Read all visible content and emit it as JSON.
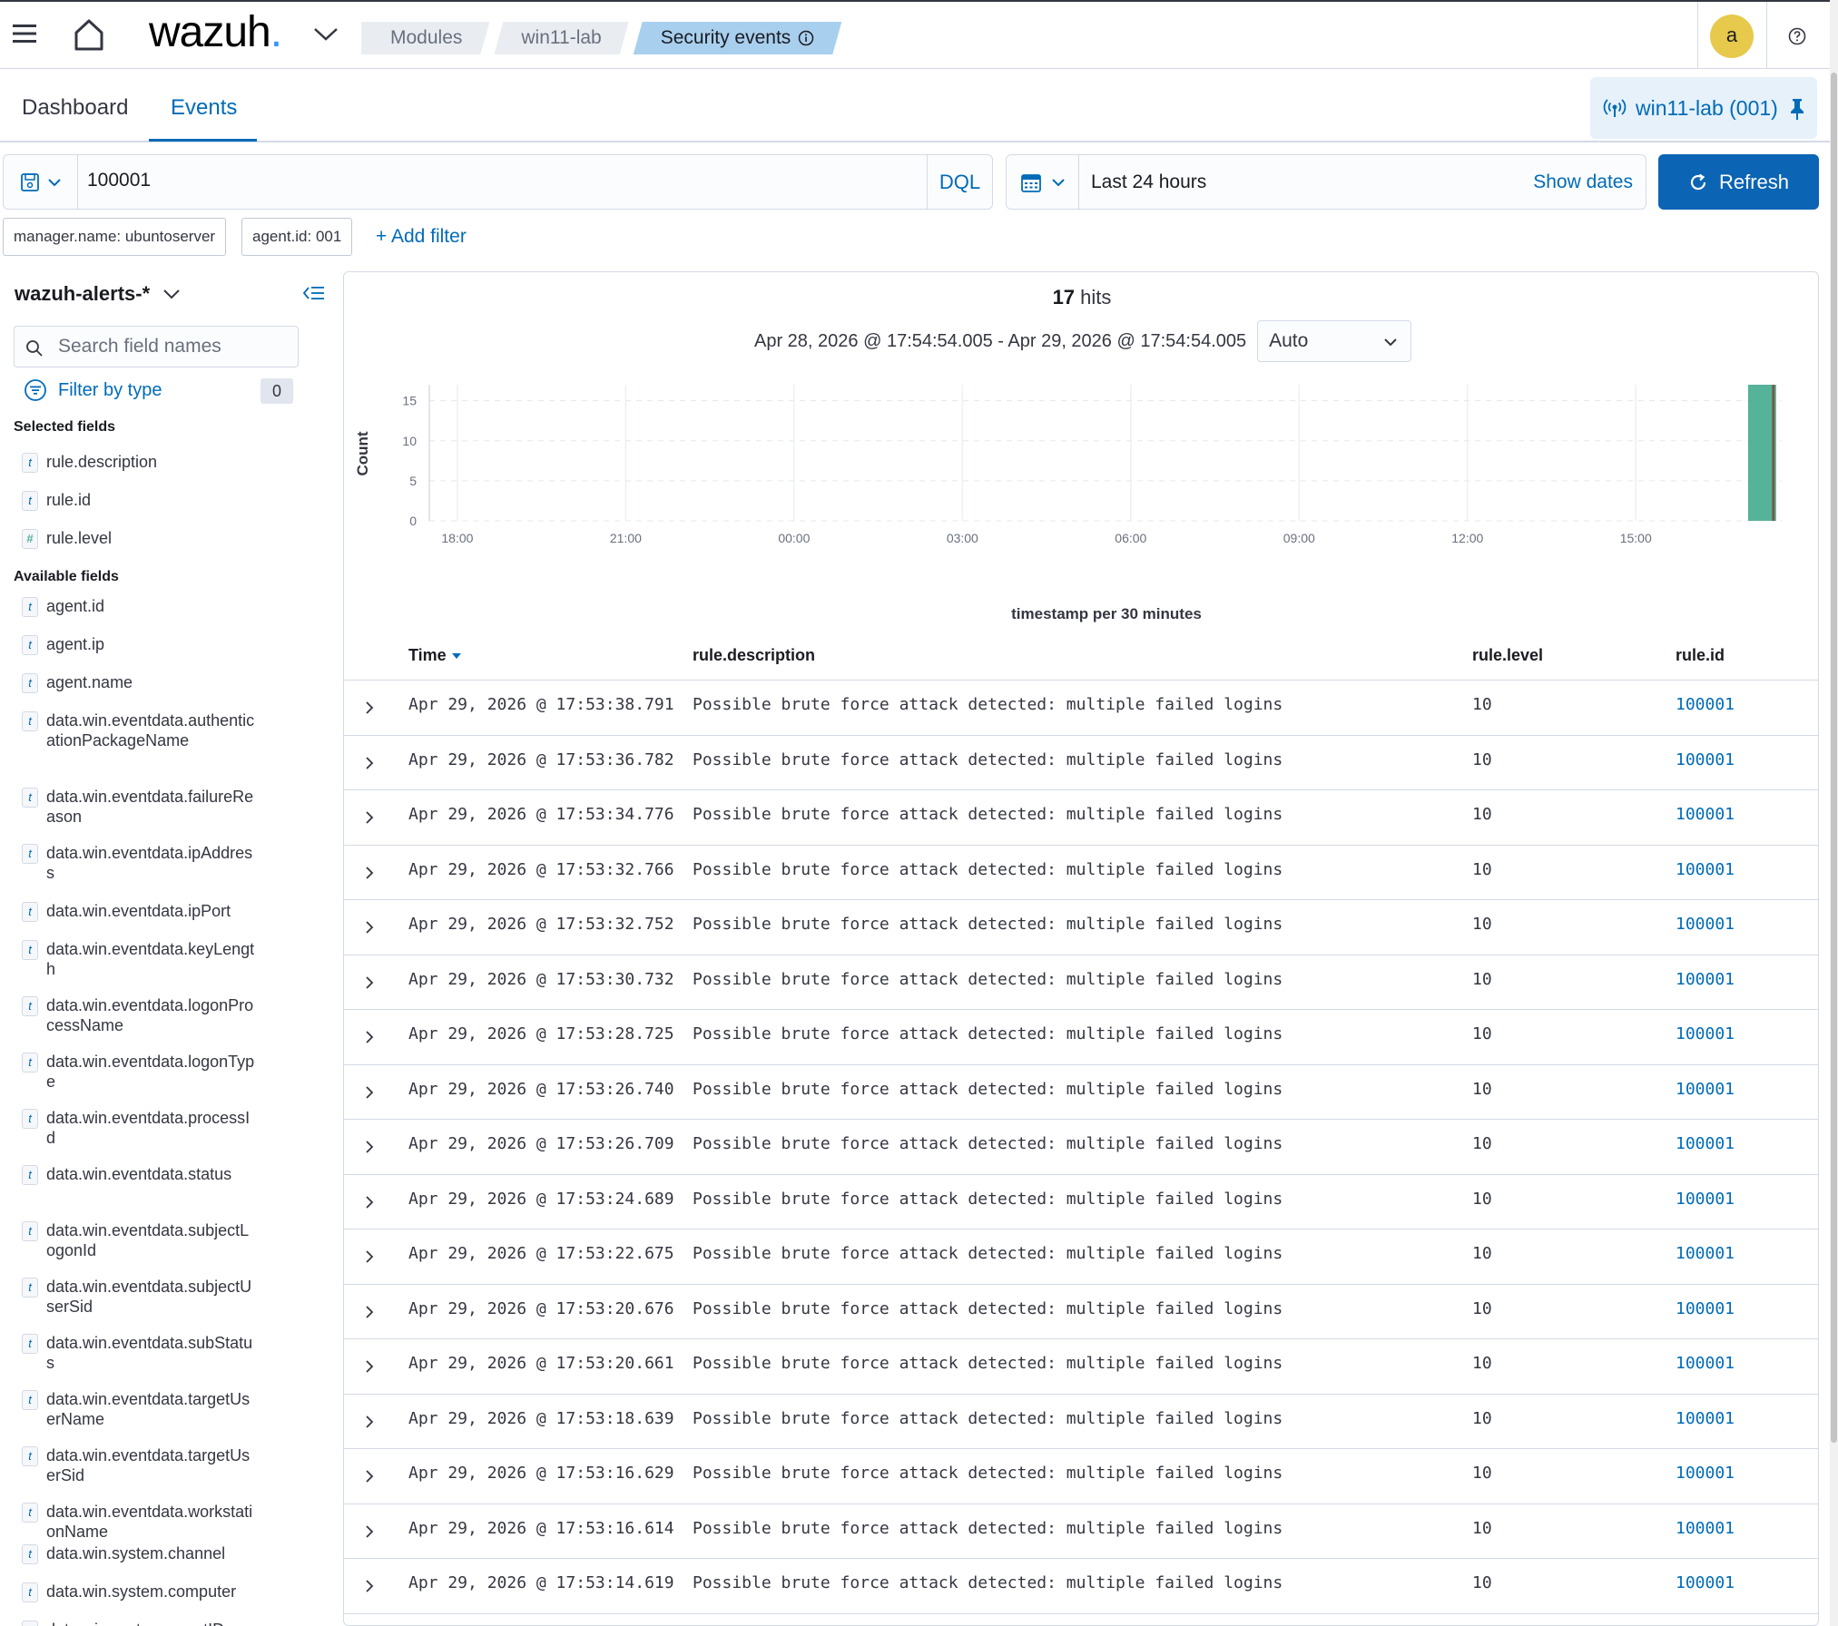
{
  "header": {
    "logo": "wazuh",
    "breadcrumbs": [
      "Modules",
      "win11-lab",
      "Security events"
    ],
    "avatar_letter": "a"
  },
  "tabs": [
    "Dashboard",
    "Events"
  ],
  "active_tab": "Events",
  "pinned_agent": "win11-lab (001)",
  "query": {
    "value": "100001",
    "language": "DQL"
  },
  "time": {
    "range": "Last 24 hours",
    "show_dates": "Show dates",
    "refresh": "Refresh"
  },
  "filters": [
    "manager.name: ubuntoserver",
    "agent.id: 001"
  ],
  "add_filter": "+ Add filter",
  "sidebar": {
    "index_pattern": "wazuh-alerts-*",
    "search_placeholder": "Search field names",
    "filter_by_type": "Filter by type",
    "filter_count": "0",
    "selected_title": "Selected fields",
    "selected_fields": [
      {
        "type": "t",
        "name": "rule.description"
      },
      {
        "type": "t",
        "name": "rule.id"
      },
      {
        "type": "#",
        "name": "rule.level"
      }
    ],
    "available_title": "Available fields",
    "available_fields": [
      {
        "type": "t",
        "name": "agent.id"
      },
      {
        "type": "t",
        "name": "agent.ip"
      },
      {
        "type": "t",
        "name": "agent.name"
      },
      {
        "type": "t",
        "name": "data.win.eventdata.authenticationPackageName"
      },
      {
        "type": "t",
        "name": "data.win.eventdata.failureReason"
      },
      {
        "type": "t",
        "name": "data.win.eventdata.ipAddress"
      },
      {
        "type": "t",
        "name": "data.win.eventdata.ipPort"
      },
      {
        "type": "t",
        "name": "data.win.eventdata.keyLength"
      },
      {
        "type": "t",
        "name": "data.win.eventdata.logonProcessName"
      },
      {
        "type": "t",
        "name": "data.win.eventdata.logonType"
      },
      {
        "type": "t",
        "name": "data.win.eventdata.processId"
      },
      {
        "type": "t",
        "name": "data.win.eventdata.status"
      },
      {
        "type": "t",
        "name": "data.win.eventdata.subjectLogonId"
      },
      {
        "type": "t",
        "name": "data.win.eventdata.subjectUserSid"
      },
      {
        "type": "t",
        "name": "data.win.eventdata.subStatus"
      },
      {
        "type": "t",
        "name": "data.win.eventdata.targetUserName"
      },
      {
        "type": "t",
        "name": "data.win.eventdata.targetUserSid"
      },
      {
        "type": "t",
        "name": "data.win.eventdata.workstationName"
      },
      {
        "type": "t",
        "name": "data.win.system.channel"
      },
      {
        "type": "t",
        "name": "data.win.system.computer"
      },
      {
        "type": "t",
        "name": "data.win.system.eventID"
      }
    ]
  },
  "hits": {
    "count": "17",
    "label": "hits",
    "date_range": "Apr 28, 2026 @ 17:54:54.005 - Apr 29, 2026 @ 17:54:54.005",
    "interval": "Auto"
  },
  "chart_data": {
    "type": "bar",
    "title": "",
    "xlabel": "timestamp per 30 minutes",
    "ylabel": "Count",
    "x_ticks": [
      "18:00",
      "21:00",
      "00:00",
      "03:00",
      "06:00",
      "09:00",
      "12:00",
      "15:00"
    ],
    "y_ticks": [
      0,
      5,
      10,
      15
    ],
    "ylim": [
      0,
      17
    ],
    "x_range_hours": [
      0,
      24
    ],
    "bars": [
      {
        "bucket": "17:30",
        "x_hours_from_start": 23.5,
        "value": 17
      }
    ],
    "bar_color": "#54b399",
    "grid": true
  },
  "table": {
    "columns": [
      "Time",
      "rule.description",
      "rule.level",
      "rule.id"
    ],
    "rows": [
      [
        "Apr 29, 2026 @ 17:53:38.791",
        "Possible brute force attack detected: multiple failed logins",
        "10",
        "100001"
      ],
      [
        "Apr 29, 2026 @ 17:53:36.782",
        "Possible brute force attack detected: multiple failed logins",
        "10",
        "100001"
      ],
      [
        "Apr 29, 2026 @ 17:53:34.776",
        "Possible brute force attack detected: multiple failed logins",
        "10",
        "100001"
      ],
      [
        "Apr 29, 2026 @ 17:53:32.766",
        "Possible brute force attack detected: multiple failed logins",
        "10",
        "100001"
      ],
      [
        "Apr 29, 2026 @ 17:53:32.752",
        "Possible brute force attack detected: multiple failed logins",
        "10",
        "100001"
      ],
      [
        "Apr 29, 2026 @ 17:53:30.732",
        "Possible brute force attack detected: multiple failed logins",
        "10",
        "100001"
      ],
      [
        "Apr 29, 2026 @ 17:53:28.725",
        "Possible brute force attack detected: multiple failed logins",
        "10",
        "100001"
      ],
      [
        "Apr 29, 2026 @ 17:53:26.740",
        "Possible brute force attack detected: multiple failed logins",
        "10",
        "100001"
      ],
      [
        "Apr 29, 2026 @ 17:53:26.709",
        "Possible brute force attack detected: multiple failed logins",
        "10",
        "100001"
      ],
      [
        "Apr 29, 2026 @ 17:53:24.689",
        "Possible brute force attack detected: multiple failed logins",
        "10",
        "100001"
      ],
      [
        "Apr 29, 2026 @ 17:53:22.675",
        "Possible brute force attack detected: multiple failed logins",
        "10",
        "100001"
      ],
      [
        "Apr 29, 2026 @ 17:53:20.676",
        "Possible brute force attack detected: multiple failed logins",
        "10",
        "100001"
      ],
      [
        "Apr 29, 2026 @ 17:53:20.661",
        "Possible brute force attack detected: multiple failed logins",
        "10",
        "100001"
      ],
      [
        "Apr 29, 2026 @ 17:53:18.639",
        "Possible brute force attack detected: multiple failed logins",
        "10",
        "100001"
      ],
      [
        "Apr 29, 2026 @ 17:53:16.629",
        "Possible brute force attack detected: multiple failed logins",
        "10",
        "100001"
      ],
      [
        "Apr 29, 2026 @ 17:53:16.614",
        "Possible brute force attack detected: multiple failed logins",
        "10",
        "100001"
      ],
      [
        "Apr 29, 2026 @ 17:53:14.619",
        "Possible brute force attack detected: multiple failed logins",
        "10",
        "100001"
      ]
    ]
  },
  "colors": {
    "accent": "#006bb8",
    "refresh_button": "#0b64b4",
    "breadcrumb_active": "#a9cfee",
    "avatar": "#e7c94b",
    "bar": "#54b399"
  }
}
